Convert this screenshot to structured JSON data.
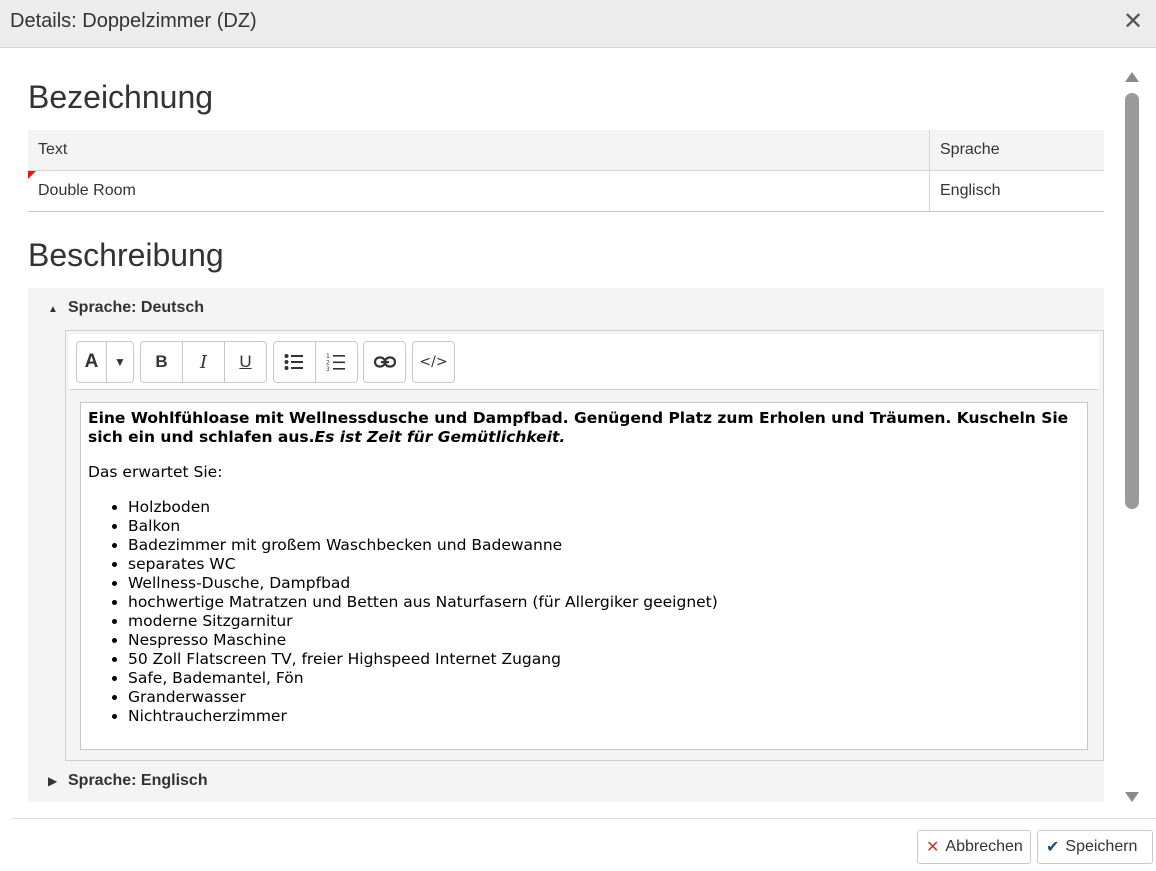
{
  "window": {
    "title": "Details: Doppelzimmer (DZ)",
    "close_glyph": "✕"
  },
  "bezeichnung": {
    "heading": "Bezeichnung",
    "columns": {
      "text": "Text",
      "language": "Sprache"
    },
    "rows": [
      {
        "text": "Double Room",
        "language": "Englisch"
      }
    ]
  },
  "beschreibung": {
    "heading": "Beschreibung",
    "sections": [
      {
        "label": "Sprache: Deutsch",
        "expanded": true,
        "glyph": "▲"
      },
      {
        "label": "Sprache: Englisch",
        "expanded": false,
        "glyph": "▶"
      }
    ],
    "toolbar": {
      "font_glyph": "A",
      "dropdown_glyph": "▼",
      "bold_glyph": "B",
      "italic_glyph": "I",
      "underline_glyph": "U",
      "code_glyph": "</>"
    },
    "content": {
      "intro_bold": "Eine Wohlfühloase mit Wellnessdusche und Dampfbad. Genügend Platz zum Erholen und Träumen. Kuscheln Sie sich ein und schlafen aus.",
      "intro_bold_italic": "Es ist Zeit für Gemütlichkeit.",
      "expect_label": "Das erwartet Sie:",
      "items": [
        "Holzboden",
        "Balkon",
        "Badezimmer mit großem Waschbecken und Badewanne",
        "separates WC",
        "Wellness-Dusche, Dampfbad",
        "hochwertige Matratzen und Betten aus Naturfasern (für Allergiker geeignet)",
        "moderne Sitzgarnitur",
        "Nespresso Maschine",
        "50 Zoll Flatscreen TV, freier Highspeed Internet Zugang",
        "Safe, Bademantel, Fön",
        "Granderwasser",
        "Nichtraucherzimmer"
      ]
    }
  },
  "footer": {
    "cancel_label": "Abbrechen",
    "cancel_glyph": "✕",
    "save_label": "Speichern",
    "save_glyph": "✔"
  },
  "colors": {
    "cancel_icon": "#c0392b",
    "save_icon": "#1f4e79",
    "required_marker": "#e11111"
  }
}
